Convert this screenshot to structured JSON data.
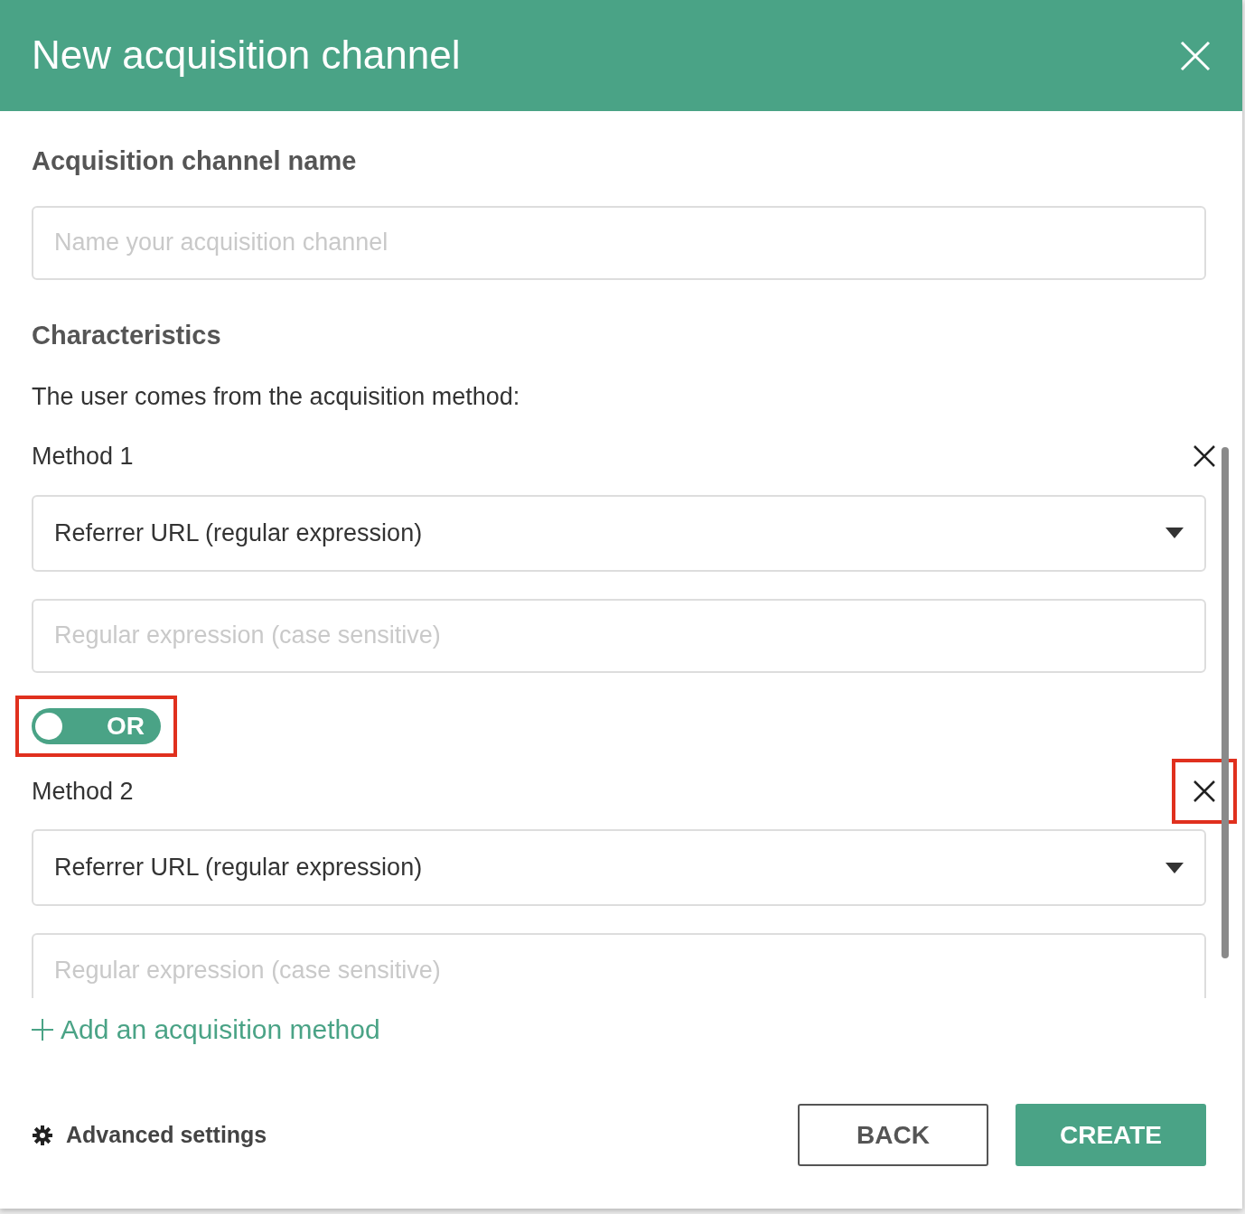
{
  "dialog": {
    "title": "New acquisition channel"
  },
  "name_section": {
    "heading": "Acquisition channel name",
    "placeholder": "Name your acquisition channel"
  },
  "characteristics": {
    "heading": "Characteristics",
    "intro": "The user comes from the acquisition method:"
  },
  "methods": [
    {
      "label": "Method 1",
      "type_value": "Referrer URL (regular expression)",
      "pattern_placeholder": "Regular expression (case sensitive)",
      "remove_highlighted": false
    },
    {
      "label": "Method 2",
      "type_value": "Referrer URL (regular expression)",
      "pattern_placeholder": "Regular expression (case sensitive)",
      "remove_highlighted": true
    }
  ],
  "connectors": [
    {
      "label": "OR",
      "on": false,
      "highlighted": true
    }
  ],
  "add_method": "Add an acquisition method",
  "footer": {
    "advanced": "Advanced settings",
    "buttons": [
      {
        "label": "BACK",
        "kind": "outline"
      },
      {
        "label": "CREATE",
        "kind": "primary"
      }
    ]
  }
}
